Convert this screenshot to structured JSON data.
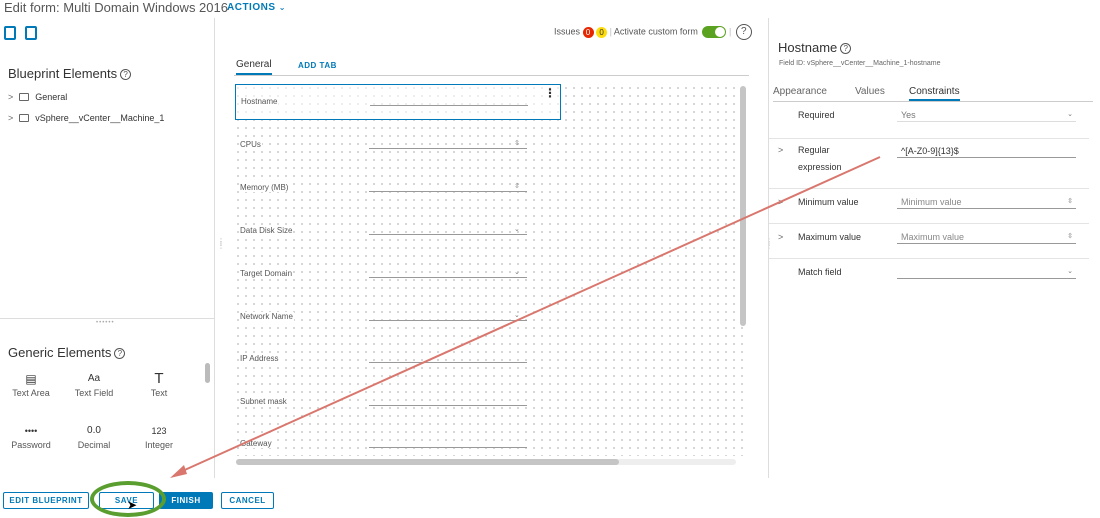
{
  "header": {
    "title": "Edit form: Multi Domain Windows 2016",
    "actions_label": "ACTIONS"
  },
  "left": {
    "blueprint_title": "Blueprint Elements",
    "tree": [
      {
        "label": "General"
      },
      {
        "label": "vSphere__vCenter__Machine_1"
      }
    ],
    "generic_title": "Generic Elements",
    "generic_items": [
      {
        "glyph": "▤",
        "label": "Text Area"
      },
      {
        "glyph": "Aa",
        "label": "Text Field"
      },
      {
        "glyph": "T",
        "label": "Text"
      },
      {
        "glyph": "••••",
        "label": "Password"
      },
      {
        "glyph": "0.0",
        "label": "Decimal"
      },
      {
        "glyph": "123",
        "label": "Integer"
      }
    ]
  },
  "center": {
    "issues_label": "Issues",
    "issues_errors": "0",
    "issues_warnings": "0",
    "custom_form_label": "Activate custom form",
    "custom_form_on": true,
    "tabs": {
      "general": "General",
      "add": "ADD TAB"
    },
    "fields": [
      {
        "label": "Hostname",
        "control": "text"
      },
      {
        "label": "CPUs",
        "control": "stepper"
      },
      {
        "label": "Memory (MB)",
        "control": "stepper"
      },
      {
        "label": "Data Disk Size",
        "control": "dropdown"
      },
      {
        "label": "Target Domain",
        "control": "dropdown"
      },
      {
        "label": "Network Name",
        "control": "dropdown"
      },
      {
        "label": "IP Address",
        "control": "text"
      },
      {
        "label": "Subnet mask",
        "control": "text"
      },
      {
        "label": "Gateway",
        "control": "text"
      }
    ]
  },
  "right": {
    "title": "Hostname",
    "field_id": "Field ID: vSphere__vCenter__Machine_1-hostname",
    "tabs": [
      "Appearance",
      "Values",
      "Constraints"
    ],
    "active_tab": "Constraints",
    "constraints": {
      "required_label": "Required",
      "required_value": "Yes",
      "regex_label": "Regular expression",
      "regex_value": "^[A-Z0-9]{13}$",
      "min_label": "Minimum value",
      "min_placeholder": "Minimum value",
      "max_label": "Maximum value",
      "max_placeholder": "Maximum value",
      "match_label": "Match field"
    }
  },
  "footer": {
    "edit_blueprint": "EDIT BLUEPRINT",
    "save": "SAVE",
    "finish": "FINISH",
    "cancel": "CANCEL"
  },
  "colors": {
    "accent": "#0079b8",
    "error_badge": "#e62700",
    "warning_badge": "#ffdc0b",
    "toggle_on": "#5aa220",
    "highlight_ring": "#5a9e2f",
    "annotation_arrow": "#d9776e"
  }
}
